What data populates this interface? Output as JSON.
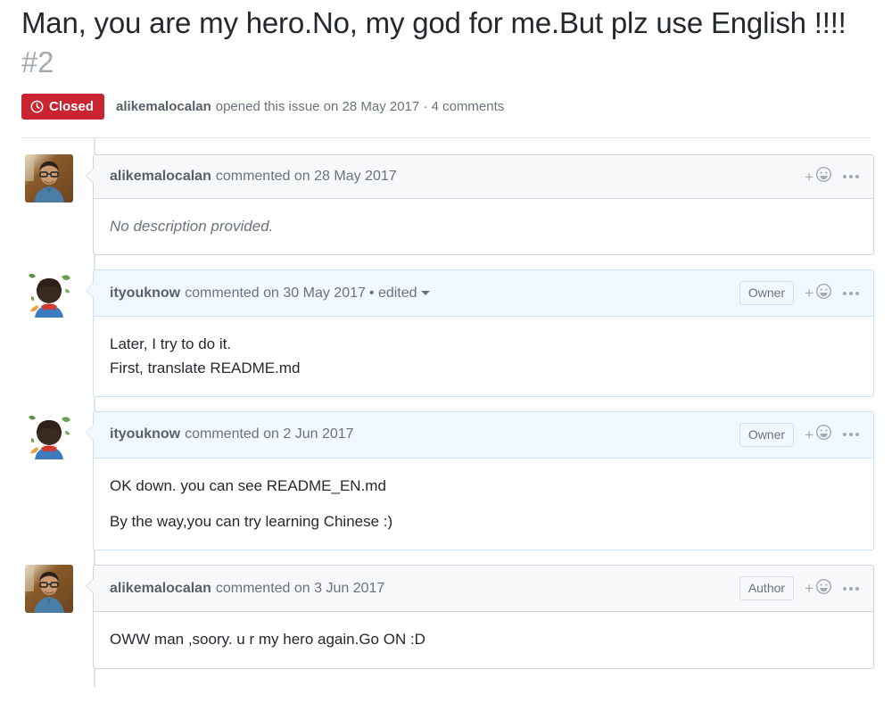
{
  "issue": {
    "title": "Man, you are my hero.No, my god for me.But plz use English !!!!",
    "number": "#2",
    "state": "Closed",
    "meta_author": "alikemalocalan",
    "meta_text": "opened this issue on 28 May 2017 · 4 comments",
    "colors": {
      "closed_badge": "#cb2431",
      "owner_header": "#f1f8ff",
      "owner_border": "#c8e1ff",
      "default_header": "#f6f8fa",
      "border": "#d1d5da",
      "muted_text": "#6a737d"
    }
  },
  "icons": {
    "issue_closed": "issue-closed-icon",
    "reaction": "smiley-plus-icon",
    "kebab": "kebab-horizontal-icon",
    "caret": "chevron-down-icon"
  },
  "comments": [
    {
      "author": "alikemalocalan",
      "action": "commented on 28 May 2017",
      "edited": "",
      "role": "",
      "owner": false,
      "avatar": "photo",
      "body_lines": [
        "No description provided."
      ],
      "body_style": "muted-italic",
      "paragraphs": false
    },
    {
      "author": "ityouknow",
      "action": "commented on 30 May 2017",
      "edited": "• edited",
      "role": "Owner",
      "owner": true,
      "avatar": "cartoon",
      "body_lines": [
        "Later, I try to do it.",
        "First, translate README.md"
      ],
      "body_style": "",
      "paragraphs": false
    },
    {
      "author": "ityouknow",
      "action": "commented on 2 Jun 2017",
      "edited": "",
      "role": "Owner",
      "owner": true,
      "avatar": "cartoon",
      "body_lines": [
        "OK down. you can see README_EN.md",
        "By the way,you can try learning Chinese :)"
      ],
      "body_style": "",
      "paragraphs": true
    },
    {
      "author": "alikemalocalan",
      "action": "commented on 3 Jun 2017",
      "edited": "",
      "role": "Author",
      "owner": false,
      "avatar": "photo",
      "body_lines": [
        "OWW man ,soory. u r my hero again.Go ON :D"
      ],
      "body_style": "",
      "paragraphs": false
    }
  ]
}
